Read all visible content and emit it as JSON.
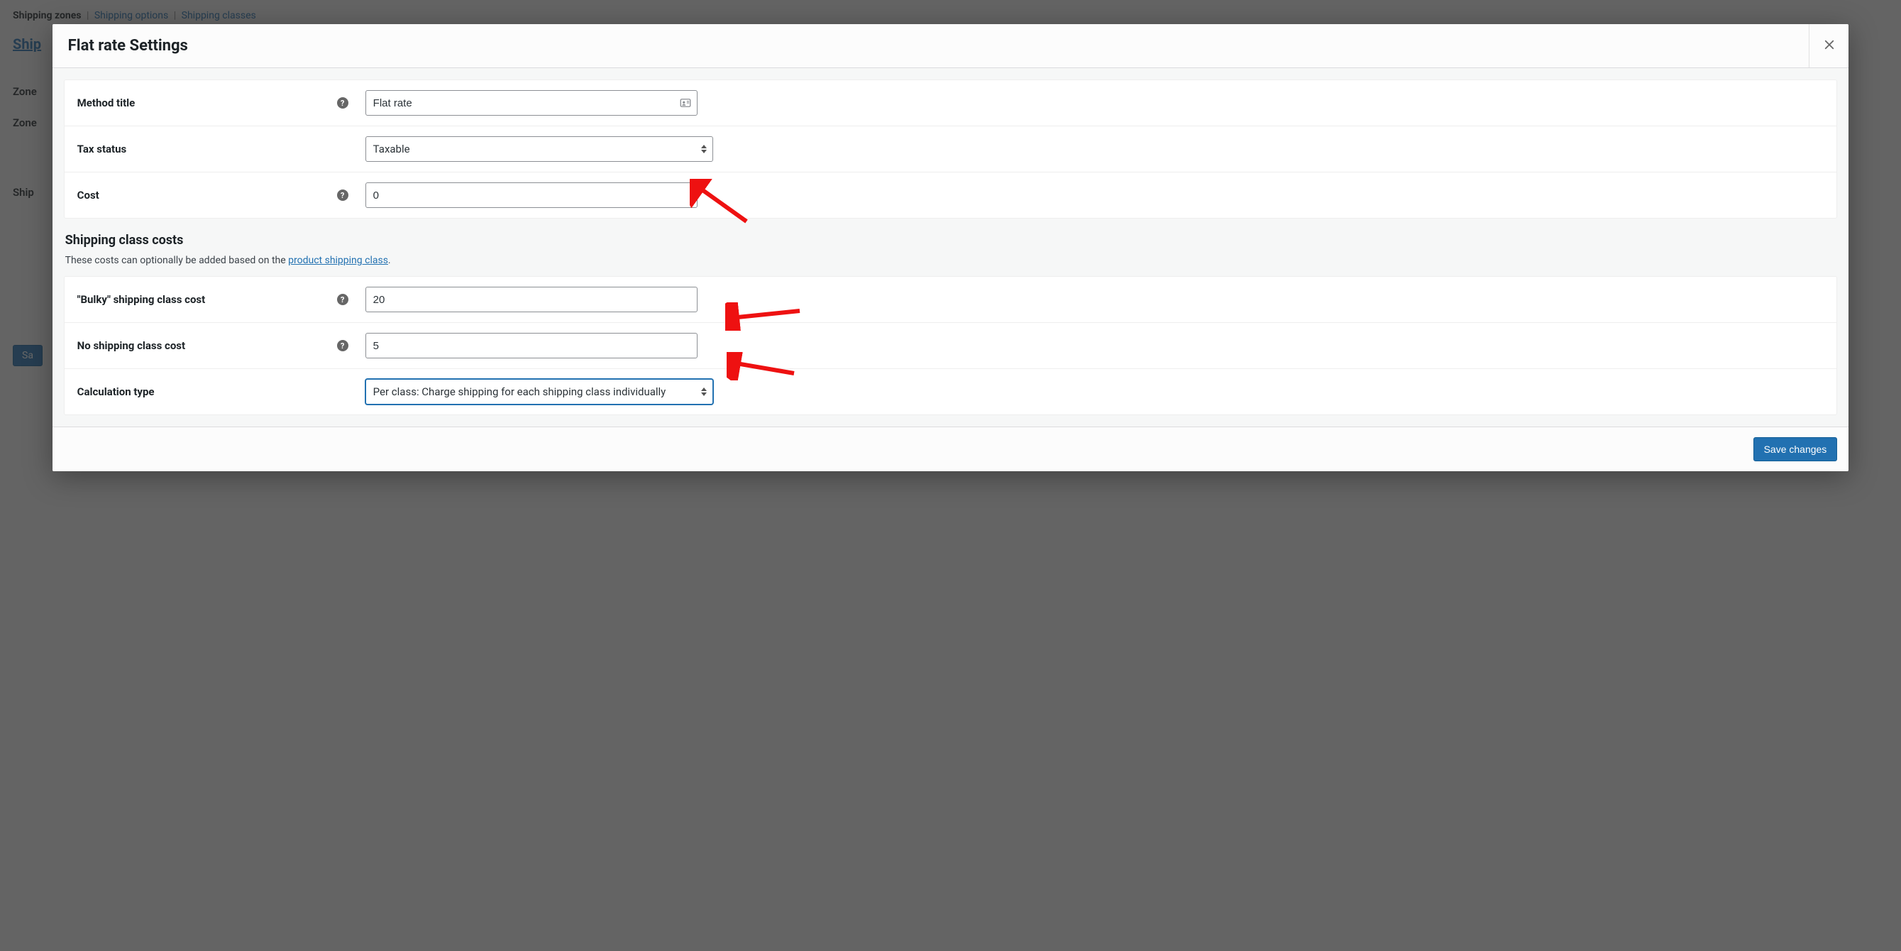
{
  "background": {
    "tabs": {
      "zones": "Shipping zones",
      "options": "Shipping options",
      "classes": "Shipping classes",
      "sep": "|"
    },
    "breadcrumb_link": "Ship",
    "zone_label_1": "Zone",
    "zone_label_2": "Zone",
    "ship_label": "Ship",
    "save_button": "Sa"
  },
  "modal": {
    "title": "Flat rate Settings",
    "close_aria": "Close",
    "save_button": "Save changes"
  },
  "fields": {
    "method_title": {
      "label": "Method title",
      "value": "Flat rate"
    },
    "tax_status": {
      "label": "Tax status",
      "value": "Taxable"
    },
    "cost": {
      "label": "Cost",
      "value": "0"
    }
  },
  "section": {
    "title": "Shipping class costs",
    "desc_prefix": "These costs can optionally be added based on the ",
    "desc_link": "product shipping class",
    "desc_suffix": "."
  },
  "class_fields": {
    "bulky": {
      "label": "\"Bulky\" shipping class cost",
      "value": "20"
    },
    "no_class": {
      "label": "No shipping class cost",
      "value": "5"
    },
    "calc": {
      "label": "Calculation type",
      "value": "Per class: Charge shipping for each shipping class individually"
    }
  }
}
